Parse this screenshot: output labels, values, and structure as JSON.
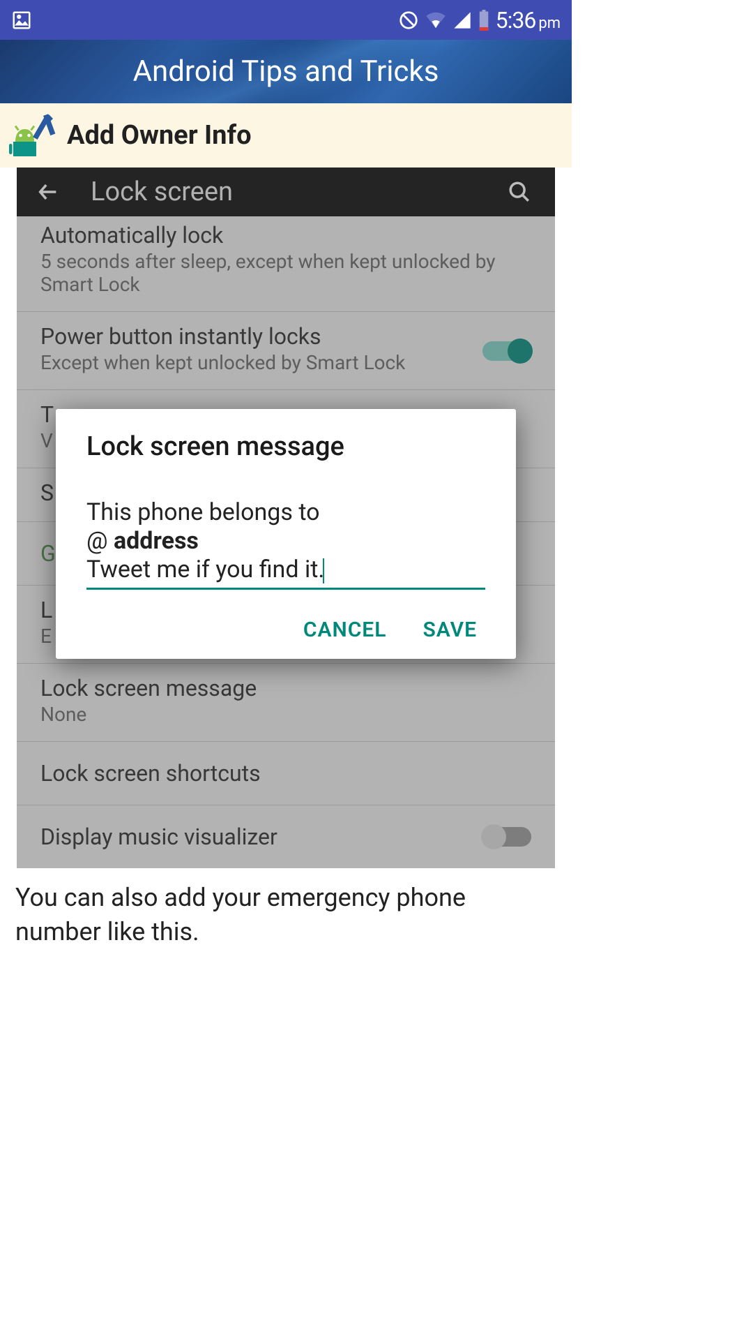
{
  "status": {
    "time": "5:36",
    "ampm": "pm"
  },
  "app_header": {
    "title": "Android Tips and Tricks"
  },
  "section": {
    "title": "Add Owner Info"
  },
  "inner": {
    "toolbar_title": "Lock screen",
    "rows": {
      "auto_lock": {
        "title": "Automatically lock",
        "sub": "5 seconds after sleep, except when kept unlocked by Smart Lock"
      },
      "power_lock": {
        "title": "Power button instantly locks",
        "sub": "Except when kept unlocked by Smart Lock"
      },
      "t_row": {
        "title": "T",
        "sub": "V"
      },
      "s_row": {
        "title": "S"
      },
      "g_row": {
        "title": "G"
      },
      "l_row": {
        "title": "L",
        "sub": "E"
      },
      "lock_msg": {
        "title": "Lock screen message",
        "sub": "None"
      },
      "shortcuts": {
        "title": "Lock screen shortcuts"
      },
      "music": {
        "title": "Display music visualizer"
      }
    }
  },
  "dialog": {
    "title": "Lock screen message",
    "line1": "This phone belongs to",
    "line2_at": "@ ",
    "line2_bold": "address",
    "line3": "Tweet me if you find it.",
    "cancel": "CANCEL",
    "save": "SAVE"
  },
  "footer": "You can also add your emergency phone number like this."
}
